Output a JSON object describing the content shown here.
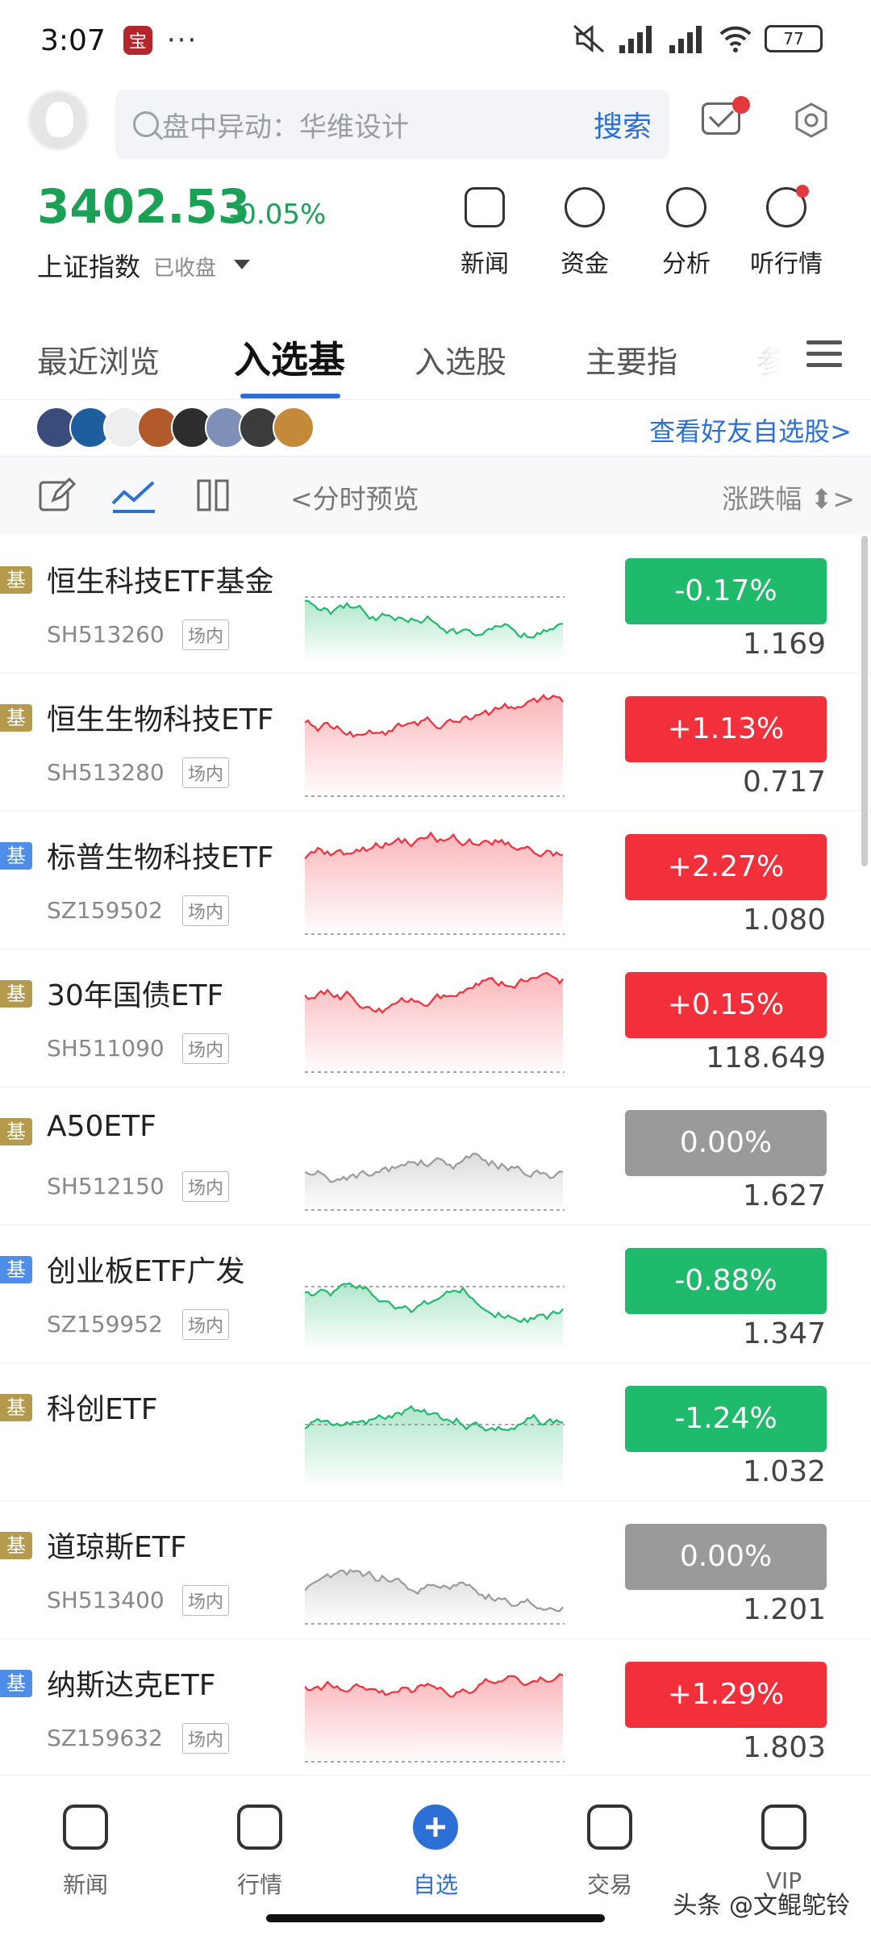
{
  "status_bar": {
    "time": "3:07",
    "app_icon_glyph": "宝",
    "dots": "···",
    "battery": "77"
  },
  "header": {
    "search_placeholder": "盘中异动：华维设计",
    "search_button": "搜索"
  },
  "index": {
    "value": "3402.53",
    "change": "-0.05%",
    "name": "上证指数",
    "state": "已收盘"
  },
  "quick_actions": [
    {
      "label": "新闻",
      "icon": "news-icon"
    },
    {
      "label": "资金",
      "icon": "funds-icon"
    },
    {
      "label": "分析",
      "icon": "analysis-icon"
    },
    {
      "label": "听行情",
      "icon": "play-icon"
    }
  ],
  "tabs": [
    {
      "label": "最近浏览"
    },
    {
      "label": "入选基"
    },
    {
      "label": "入选股"
    },
    {
      "label": "主要指"
    },
    {
      "label": "参"
    }
  ],
  "friends": {
    "link": "查看好友自选股>"
  },
  "toolbar": {
    "preview_label": "<分时预览",
    "sort_label": "涨跌幅 ⬍>"
  },
  "colors": {
    "up": "#f2303c",
    "down": "#1fba6b",
    "flat": "#9a9a9a",
    "accent": "#2c6fd5",
    "tag_gold": "#b59a4d",
    "tag_blue": "#4f8ee8"
  },
  "funds": [
    {
      "tag": "基",
      "tag_color": "gold",
      "name": "恒生科技ETF基金",
      "code": "SH513260",
      "market": "场内",
      "change": "-0.17%",
      "trend": "down",
      "price": "1.169"
    },
    {
      "tag": "基",
      "tag_color": "gold",
      "name": "恒生生物科技ETF",
      "code": "SH513280",
      "market": "场内",
      "change": "+1.13%",
      "trend": "up",
      "price": "0.717"
    },
    {
      "tag": "基",
      "tag_color": "blue",
      "name": "标普生物科技ETF",
      "code": "SZ159502",
      "market": "场内",
      "change": "+2.27%",
      "trend": "up",
      "price": "1.080"
    },
    {
      "tag": "基",
      "tag_color": "gold",
      "name": "30年国债ETF",
      "code": "SH511090",
      "market": "场内",
      "change": "+0.15%",
      "trend": "up",
      "price": "118.649"
    },
    {
      "tag": "基",
      "tag_color": "gold",
      "name": "A50ETF",
      "code": "SH512150",
      "market": "场内",
      "change": "0.00%",
      "trend": "flat",
      "price": "1.627"
    },
    {
      "tag": "基",
      "tag_color": "blue",
      "name": "创业板ETF广发",
      "code": "SZ159952",
      "market": "场内",
      "change": "-0.88%",
      "trend": "down",
      "price": "1.347"
    },
    {
      "tag": "基",
      "tag_color": "gold",
      "name": "科创ETF",
      "code": "",
      "market": "",
      "change": "-1.24%",
      "trend": "down",
      "price": "1.032"
    },
    {
      "tag": "基",
      "tag_color": "gold",
      "name": "道琼斯ETF",
      "code": "SH513400",
      "market": "场内",
      "change": "0.00%",
      "trend": "flat",
      "price": "1.201"
    },
    {
      "tag": "基",
      "tag_color": "blue",
      "name": "纳斯达克ETF",
      "code": "SZ159632",
      "market": "场内",
      "change": "+1.29%",
      "trend": "up",
      "price": "1.803"
    }
  ],
  "bottom_nav": [
    {
      "label": "新闻",
      "icon": "news-nav-icon"
    },
    {
      "label": "行情",
      "icon": "market-nav-icon"
    },
    {
      "label": "自选",
      "icon": "plus-nav-icon"
    },
    {
      "label": "交易",
      "icon": "trade-nav-icon"
    },
    {
      "label": "VIP",
      "icon": "vip-nav-icon"
    }
  ],
  "watermark": "头条 @文鲲鸵铃"
}
